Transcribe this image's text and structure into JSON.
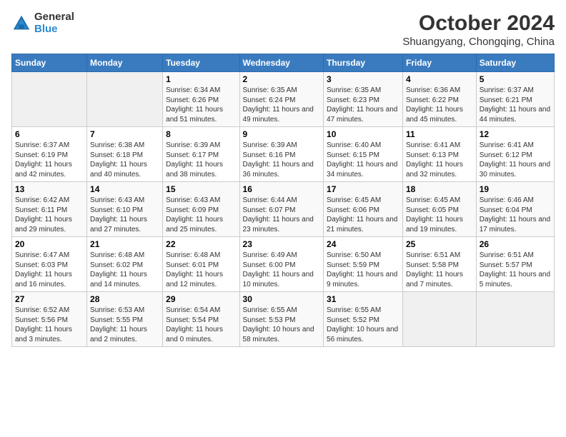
{
  "header": {
    "title": "October 2024",
    "subtitle": "Shuangyang, Chongqing, China",
    "logo_line1": "General",
    "logo_line2": "Blue"
  },
  "columns": [
    "Sunday",
    "Monday",
    "Tuesday",
    "Wednesday",
    "Thursday",
    "Friday",
    "Saturday"
  ],
  "weeks": [
    [
      {
        "day": "",
        "info": ""
      },
      {
        "day": "",
        "info": ""
      },
      {
        "day": "1",
        "info": "Sunrise: 6:34 AM\nSunset: 6:26 PM\nDaylight: 11 hours and 51 minutes."
      },
      {
        "day": "2",
        "info": "Sunrise: 6:35 AM\nSunset: 6:24 PM\nDaylight: 11 hours and 49 minutes."
      },
      {
        "day": "3",
        "info": "Sunrise: 6:35 AM\nSunset: 6:23 PM\nDaylight: 11 hours and 47 minutes."
      },
      {
        "day": "4",
        "info": "Sunrise: 6:36 AM\nSunset: 6:22 PM\nDaylight: 11 hours and 45 minutes."
      },
      {
        "day": "5",
        "info": "Sunrise: 6:37 AM\nSunset: 6:21 PM\nDaylight: 11 hours and 44 minutes."
      }
    ],
    [
      {
        "day": "6",
        "info": "Sunrise: 6:37 AM\nSunset: 6:19 PM\nDaylight: 11 hours and 42 minutes."
      },
      {
        "day": "7",
        "info": "Sunrise: 6:38 AM\nSunset: 6:18 PM\nDaylight: 11 hours and 40 minutes."
      },
      {
        "day": "8",
        "info": "Sunrise: 6:39 AM\nSunset: 6:17 PM\nDaylight: 11 hours and 38 minutes."
      },
      {
        "day": "9",
        "info": "Sunrise: 6:39 AM\nSunset: 6:16 PM\nDaylight: 11 hours and 36 minutes."
      },
      {
        "day": "10",
        "info": "Sunrise: 6:40 AM\nSunset: 6:15 PM\nDaylight: 11 hours and 34 minutes."
      },
      {
        "day": "11",
        "info": "Sunrise: 6:41 AM\nSunset: 6:13 PM\nDaylight: 11 hours and 32 minutes."
      },
      {
        "day": "12",
        "info": "Sunrise: 6:41 AM\nSunset: 6:12 PM\nDaylight: 11 hours and 30 minutes."
      }
    ],
    [
      {
        "day": "13",
        "info": "Sunrise: 6:42 AM\nSunset: 6:11 PM\nDaylight: 11 hours and 29 minutes."
      },
      {
        "day": "14",
        "info": "Sunrise: 6:43 AM\nSunset: 6:10 PM\nDaylight: 11 hours and 27 minutes."
      },
      {
        "day": "15",
        "info": "Sunrise: 6:43 AM\nSunset: 6:09 PM\nDaylight: 11 hours and 25 minutes."
      },
      {
        "day": "16",
        "info": "Sunrise: 6:44 AM\nSunset: 6:07 PM\nDaylight: 11 hours and 23 minutes."
      },
      {
        "day": "17",
        "info": "Sunrise: 6:45 AM\nSunset: 6:06 PM\nDaylight: 11 hours and 21 minutes."
      },
      {
        "day": "18",
        "info": "Sunrise: 6:45 AM\nSunset: 6:05 PM\nDaylight: 11 hours and 19 minutes."
      },
      {
        "day": "19",
        "info": "Sunrise: 6:46 AM\nSunset: 6:04 PM\nDaylight: 11 hours and 17 minutes."
      }
    ],
    [
      {
        "day": "20",
        "info": "Sunrise: 6:47 AM\nSunset: 6:03 PM\nDaylight: 11 hours and 16 minutes."
      },
      {
        "day": "21",
        "info": "Sunrise: 6:48 AM\nSunset: 6:02 PM\nDaylight: 11 hours and 14 minutes."
      },
      {
        "day": "22",
        "info": "Sunrise: 6:48 AM\nSunset: 6:01 PM\nDaylight: 11 hours and 12 minutes."
      },
      {
        "day": "23",
        "info": "Sunrise: 6:49 AM\nSunset: 6:00 PM\nDaylight: 11 hours and 10 minutes."
      },
      {
        "day": "24",
        "info": "Sunrise: 6:50 AM\nSunset: 5:59 PM\nDaylight: 11 hours and 9 minutes."
      },
      {
        "day": "25",
        "info": "Sunrise: 6:51 AM\nSunset: 5:58 PM\nDaylight: 11 hours and 7 minutes."
      },
      {
        "day": "26",
        "info": "Sunrise: 6:51 AM\nSunset: 5:57 PM\nDaylight: 11 hours and 5 minutes."
      }
    ],
    [
      {
        "day": "27",
        "info": "Sunrise: 6:52 AM\nSunset: 5:56 PM\nDaylight: 11 hours and 3 minutes."
      },
      {
        "day": "28",
        "info": "Sunrise: 6:53 AM\nSunset: 5:55 PM\nDaylight: 11 hours and 2 minutes."
      },
      {
        "day": "29",
        "info": "Sunrise: 6:54 AM\nSunset: 5:54 PM\nDaylight: 11 hours and 0 minutes."
      },
      {
        "day": "30",
        "info": "Sunrise: 6:55 AM\nSunset: 5:53 PM\nDaylight: 10 hours and 58 minutes."
      },
      {
        "day": "31",
        "info": "Sunrise: 6:55 AM\nSunset: 5:52 PM\nDaylight: 10 hours and 56 minutes."
      },
      {
        "day": "",
        "info": ""
      },
      {
        "day": "",
        "info": ""
      }
    ]
  ]
}
